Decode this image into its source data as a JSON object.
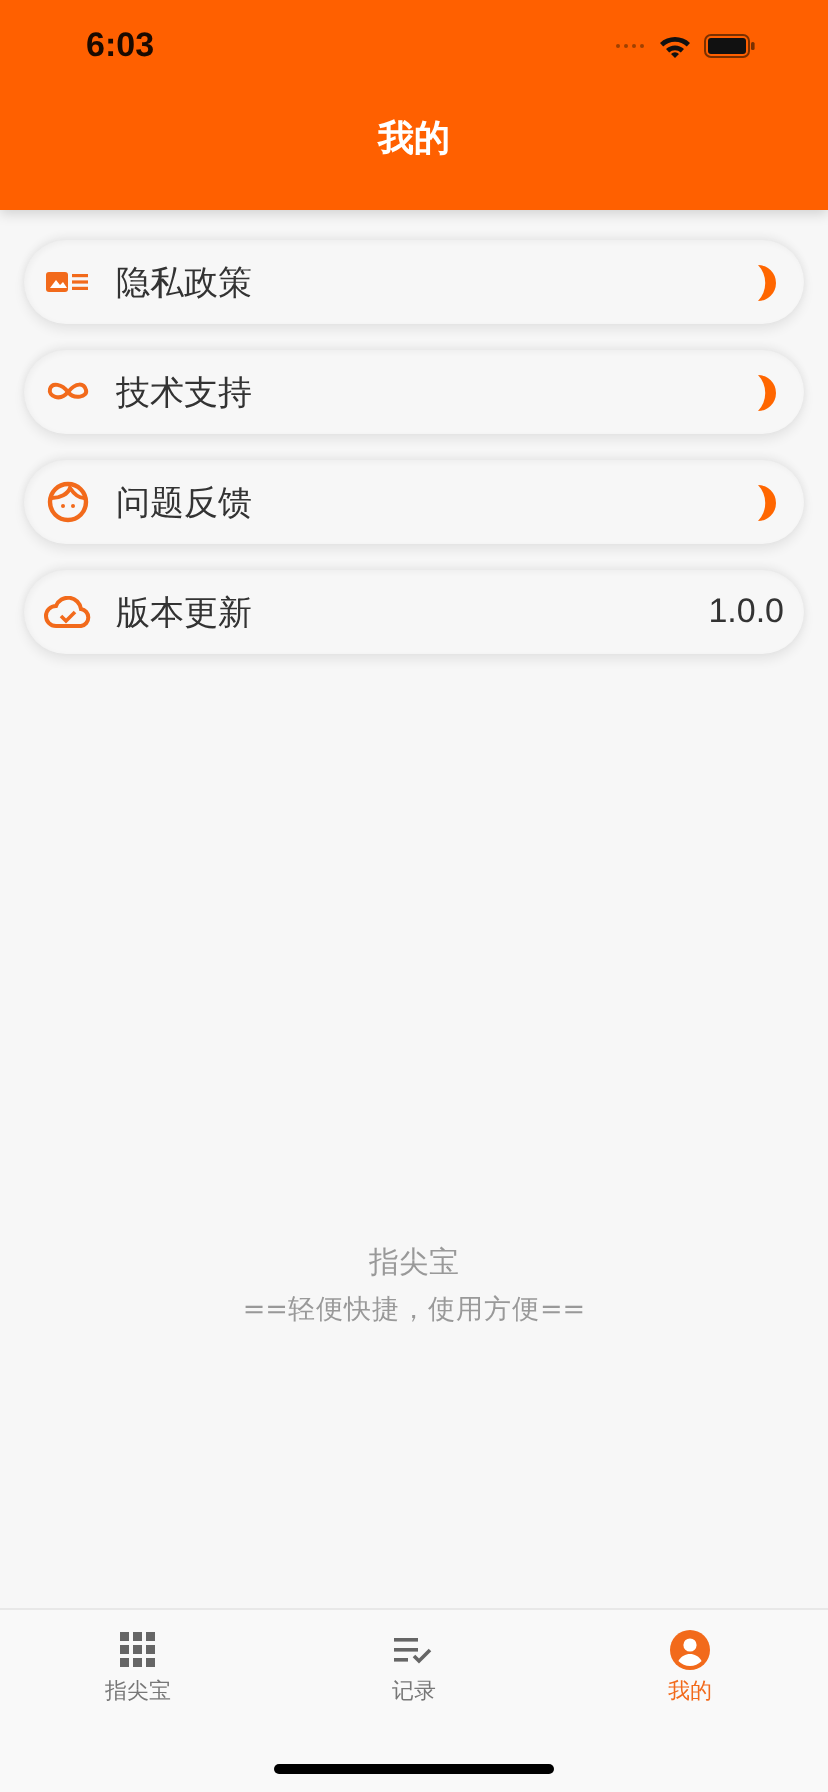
{
  "status_bar": {
    "time": "6:03"
  },
  "header": {
    "title": "我的"
  },
  "menu": [
    {
      "label": "隐私政策",
      "kind": "link"
    },
    {
      "label": "技术支持",
      "kind": "link"
    },
    {
      "label": "问题反馈",
      "kind": "link"
    },
    {
      "label": "版本更新",
      "kind": "value",
      "value": "1.0.0"
    }
  ],
  "footer": {
    "app_name": "指尖宝",
    "slogan": "==轻便快捷，使用方便=="
  },
  "tabs": [
    {
      "label": "指尖宝",
      "selected": false
    },
    {
      "label": "记录",
      "selected": false
    },
    {
      "label": "我的",
      "selected": true
    }
  ]
}
